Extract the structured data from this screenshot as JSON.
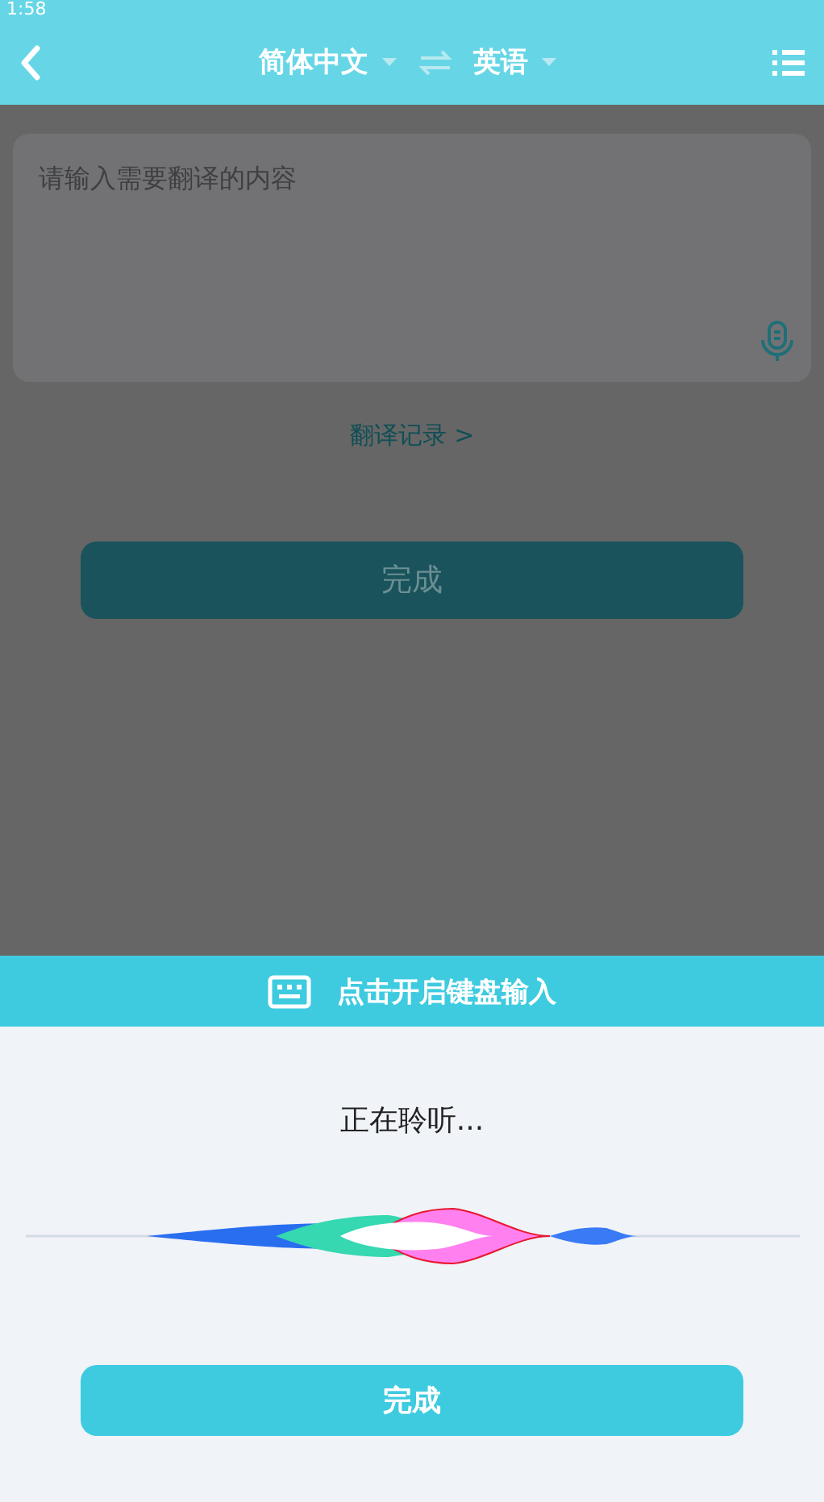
{
  "status_bar": {
    "time": "1:58"
  },
  "toolbar": {
    "source_language": "简体中文",
    "target_language": "英语"
  },
  "input": {
    "placeholder": "请输入需要翻译的内容"
  },
  "history_link": "翻译记录 >",
  "done_button": "完成",
  "voice_panel": {
    "keyboard_bar": "点击开启键盘输入",
    "status": "正在聆听...",
    "done_button": "完成"
  }
}
